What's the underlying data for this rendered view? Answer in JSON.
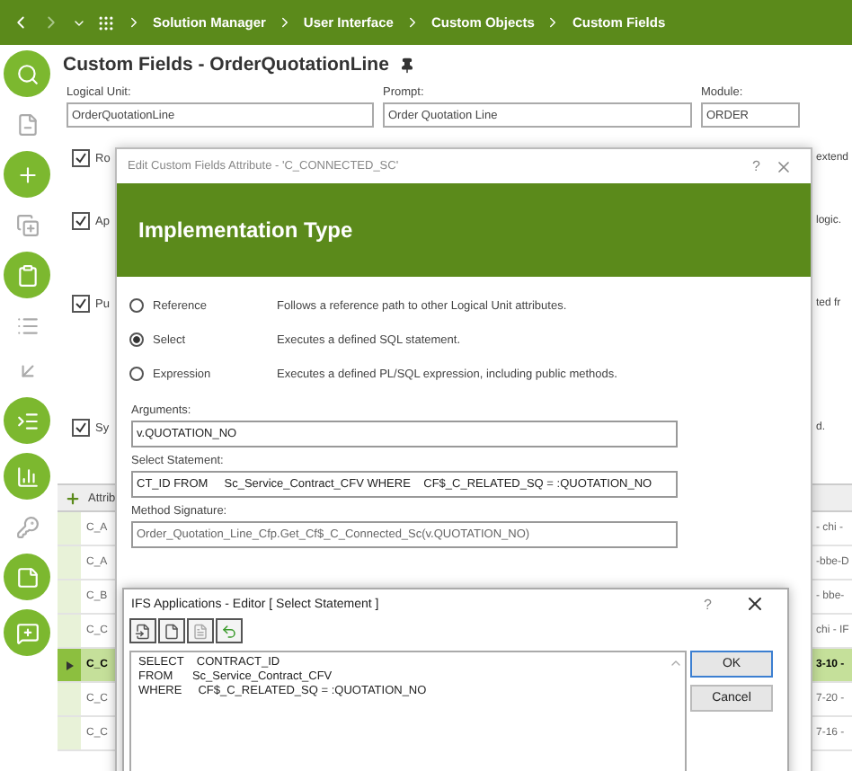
{
  "nav": {
    "breadcrumbs": [
      "Solution Manager",
      "User Interface",
      "Custom Objects",
      "Custom Fields"
    ]
  },
  "page": {
    "title": "Custom Fields - OrderQuotationLine",
    "fields": [
      {
        "label": "Logical Unit:",
        "value": "OrderQuotationLine"
      },
      {
        "label": "Prompt:",
        "value": "Order Quotation Line"
      },
      {
        "label": "Module:",
        "value": "ORDER"
      }
    ],
    "options": [
      {
        "label": "Ro",
        "trailing": "extend",
        "checked": true
      },
      {
        "label": "Ap",
        "trailing": "logic.",
        "checked": true
      },
      {
        "label": "Pu",
        "trailing": "ted fr",
        "checked": true
      },
      {
        "label": "Sy",
        "trailing": "d.",
        "checked": true
      }
    ],
    "table": {
      "header": "Attrib",
      "rows": [
        {
          "column_1": "C_A",
          "column_2": "- chi -",
          "selected": false
        },
        {
          "column_1": "C_A",
          "column_2": "-bbe-D",
          "selected": false
        },
        {
          "column_1": "C_B",
          "column_2": "- bbe-",
          "selected": false
        },
        {
          "column_1": "C_C",
          "column_2": "chi - IF",
          "selected": false
        },
        {
          "column_1": "C_C",
          "column_2": "3-10 -",
          "selected": true
        },
        {
          "column_1": "C_C",
          "column_2": "7-20 -",
          "selected": false
        },
        {
          "column_1": "C_C",
          "column_2": "7-16 -",
          "selected": false
        }
      ]
    }
  },
  "dialog": {
    "title": "Edit Custom Fields Attribute - 'C_CONNECTED_SC'",
    "help": "?",
    "heading": "Implementation Type",
    "types": [
      {
        "label": "Reference",
        "description": "Follows a reference path to other Logical Unit attributes.",
        "selected": false
      },
      {
        "label": "Select",
        "description": "Executes a defined SQL statement.",
        "selected": true
      },
      {
        "label": "Expression",
        "description": "Executes a defined PL/SQL expression, including public methods.",
        "selected": false
      }
    ],
    "fields": [
      {
        "label": "Arguments:",
        "value": "v.QUOTATION_NO",
        "disabled": false
      },
      {
        "label": "Select Statement:",
        "value": "CT_ID FROM     Sc_Service_Contract_CFV WHERE    CF$_C_RELATED_SQ = :QUOTATION_NO",
        "disabled": false
      },
      {
        "label": "Method Signature:",
        "value": "Order_Quotation_Line_Cfp.Get_Cf$_C_Connected_Sc(v.QUOTATION_NO)",
        "disabled": true
      }
    ]
  },
  "editor": {
    "title": "IFS Applications - Editor [ Select Statement ]",
    "help": "?",
    "lines": [
      "SELECT    CONTRACT_ID",
      "FROM      Sc_Service_Contract_CFV",
      "WHERE     CF$_C_RELATED_SQ = :QUOTATION_NO"
    ],
    "buttons": [
      {
        "label": "OK",
        "default": true
      },
      {
        "label": "Cancel",
        "default": false
      }
    ]
  }
}
